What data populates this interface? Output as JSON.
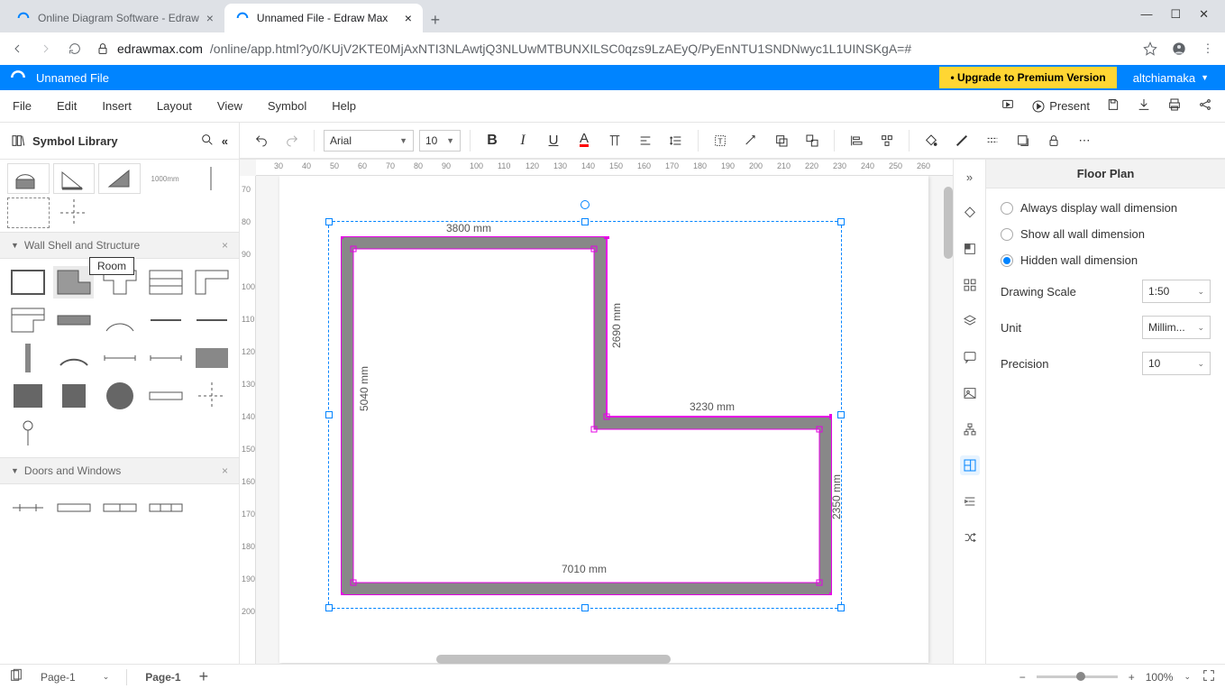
{
  "browser": {
    "tabs": [
      {
        "title": "Online Diagram Software - Edraw",
        "active": false
      },
      {
        "title": "Unnamed File - Edraw Max",
        "active": true
      }
    ],
    "url_host": "edrawmax.com",
    "url_path": "/online/app.html?y0/KUjV2KTE0MjAxNTI3NLAwtjQ3NLUwMTBUNXILSC0qzs9LzAEyQ/PyEnNTU1SNDNwyc1L1UINSKgA=#"
  },
  "app": {
    "title": "Unnamed File",
    "upgrade": "• Upgrade to Premium Version",
    "user": "altchiamaka"
  },
  "menubar": [
    "File",
    "Edit",
    "Insert",
    "Layout",
    "View",
    "Symbol",
    "Help"
  ],
  "menubar_right": {
    "present": "Present"
  },
  "sidebar": {
    "title": "Symbol Library",
    "sections": {
      "wall": "Wall Shell and Structure",
      "doors": "Doors and Windows"
    },
    "tooltip": "Room"
  },
  "toolbar": {
    "font": "Arial",
    "size": "10"
  },
  "ruler_h": [
    "30",
    "40",
    "50",
    "60",
    "70",
    "80",
    "90",
    "100",
    "110",
    "120",
    "130",
    "140",
    "150",
    "160",
    "170",
    "180",
    "190",
    "200",
    "210",
    "220",
    "230",
    "240",
    "250",
    "260"
  ],
  "ruler_v": [
    "70",
    "80",
    "90",
    "100",
    "110",
    "120",
    "130",
    "140",
    "150",
    "160",
    "170",
    "180",
    "190",
    "200"
  ],
  "dims": {
    "top": "3800 mm",
    "left": "5040 mm",
    "mid_v": "2690 mm",
    "mid_h": "3230 mm",
    "right": "2350 mm",
    "bottom": "7010 mm"
  },
  "panel": {
    "title": "Floor Plan",
    "radio1": "Always display wall dimension",
    "radio2": "Show all wall dimension",
    "radio3": "Hidden wall dimension",
    "scale_label": "Drawing Scale",
    "scale_value": "1:50",
    "unit_label": "Unit",
    "unit_value": "Millim...",
    "precision_label": "Precision",
    "precision_value": "10"
  },
  "status": {
    "page_select": "Page-1",
    "page_tab": "Page-1",
    "zoom": "100%"
  },
  "thumb_label": "1000mm"
}
